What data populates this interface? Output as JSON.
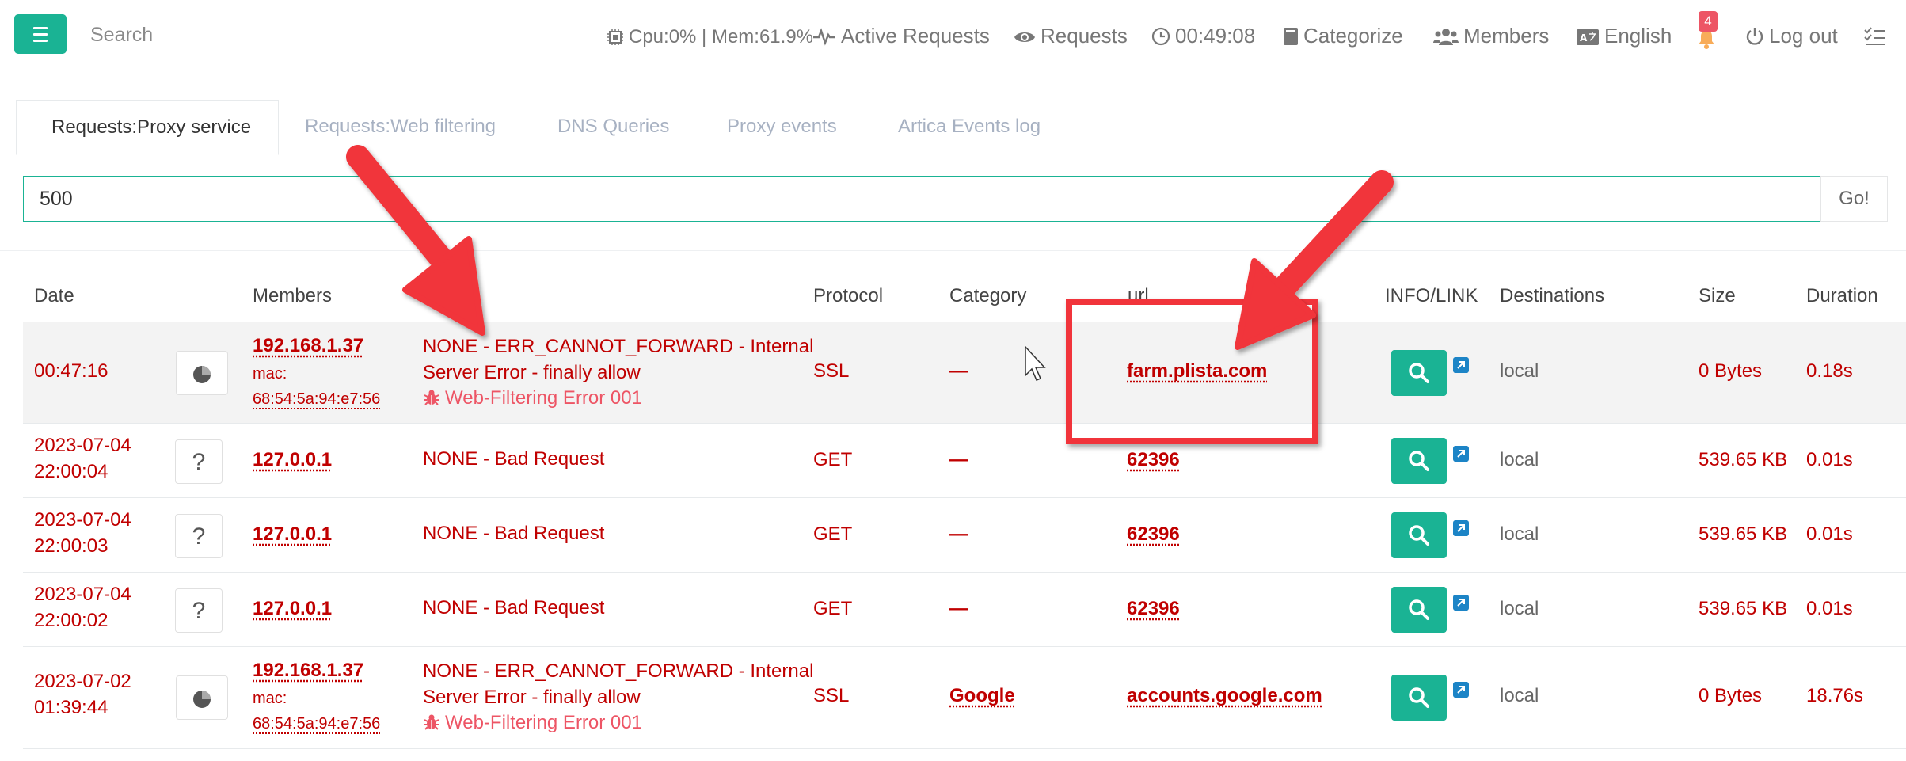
{
  "topbar": {
    "search_label": "Search",
    "cpu_mem": "Cpu:0% | Mem:61.9%",
    "active_requests": "Active Requests",
    "requests": "Requests",
    "clock": "00:49:08",
    "categorize": "Categorize",
    "members": "Members",
    "language": "English",
    "notifications_count": "4",
    "logout": "Log out"
  },
  "tabs": [
    {
      "label": "Requests:Proxy service",
      "active": true
    },
    {
      "label": "Requests:Web filtering",
      "active": false
    },
    {
      "label": "DNS Queries",
      "active": false
    },
    {
      "label": "Proxy events",
      "active": false
    },
    {
      "label": "Artica Events log",
      "active": false
    }
  ],
  "search": {
    "value": "500",
    "go_label": "Go!"
  },
  "table": {
    "headers": {
      "date": "Date",
      "members": "Members",
      "protocol": "Protocol",
      "category": "Category",
      "url": "url",
      "info_link": "INFO/LINK",
      "destinations": "Destinations",
      "size": "Size",
      "duration": "Duration"
    },
    "rows": [
      {
        "date_1": "00:47:16",
        "date_2": "",
        "icon": "●",
        "ip": "192.168.1.37",
        "mac_label": "mac:",
        "mac": "68:54:5a:94:e7:56",
        "status_1": "NONE - ERR_CANNOT_FORWARD - Internal",
        "status_2": "Server Error - finally allow",
        "web_filter": "Web-Filtering Error 001",
        "protocol": "SSL",
        "category": "—",
        "url": "farm.plista.com",
        "destination": "local",
        "size": "0 Bytes",
        "duration": "0.18s"
      },
      {
        "date_1": "2023-07-04",
        "date_2": "22:00:04",
        "icon": "?",
        "ip": "127.0.0.1",
        "status_1": "NONE - Bad Request",
        "protocol": "GET",
        "category": "—",
        "url": "62396",
        "destination": "local",
        "size": "539.65 KB",
        "duration": "0.01s"
      },
      {
        "date_1": "2023-07-04",
        "date_2": "22:00:03",
        "icon": "?",
        "ip": "127.0.0.1",
        "status_1": "NONE - Bad Request",
        "protocol": "GET",
        "category": "—",
        "url": "62396",
        "destination": "local",
        "size": "539.65 KB",
        "duration": "0.01s"
      },
      {
        "date_1": "2023-07-04",
        "date_2": "22:00:02",
        "icon": "?",
        "ip": "127.0.0.1",
        "status_1": "NONE - Bad Request",
        "protocol": "GET",
        "category": "—",
        "url": "62396",
        "destination": "local",
        "size": "539.65 KB",
        "duration": "0.01s"
      },
      {
        "date_1": "2023-07-02",
        "date_2": "01:39:44",
        "icon": "●",
        "ip": "192.168.1.37",
        "mac_label": "mac:",
        "mac": "68:54:5a:94:e7:56",
        "status_1": "NONE - ERR_CANNOT_FORWARD - Internal",
        "status_2": "Server Error - finally allow",
        "web_filter": "Web-Filtering Error 001",
        "protocol": "SSL",
        "category": "Google",
        "url": "accounts.google.com",
        "destination": "local",
        "size": "0 Bytes",
        "duration": "18.76s"
      }
    ]
  },
  "colors": {
    "accent": "#1ab394",
    "error_red": "#c00000",
    "annotation_red": "#f1343b",
    "badge_red": "#ed5565",
    "link_blue": "#1c84c6"
  }
}
